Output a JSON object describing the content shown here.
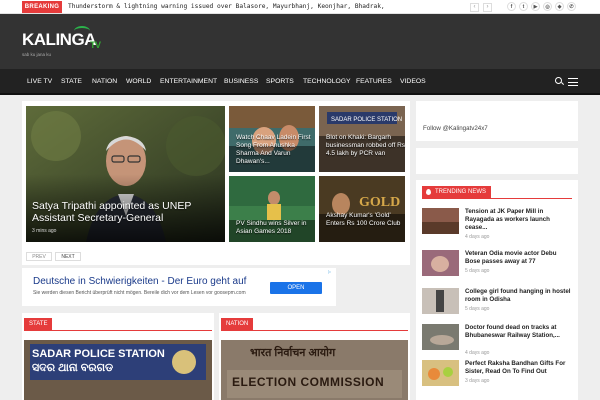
{
  "topbar": {
    "breaking_label": "BREAKING",
    "ticker_text": "Thunderstorm & lightning warning issued over Balasore, Mayurbhanj, Keonjhar, Bhadrak, An...",
    "prev_icon": "chevron-left-icon",
    "next_icon": "chevron-right-icon",
    "social": [
      "f",
      "t",
      "▶",
      "◎",
      "◆",
      "✆"
    ]
  },
  "header": {
    "logo_text": "KALINGA",
    "logo_tv": "TV",
    "tagline": "sab ku jana ku"
  },
  "nav": {
    "items": [
      "LIVE TV",
      "STATE",
      "NATION",
      "WORLD",
      "ENTERTAINMENT",
      "BUSINESS",
      "SPORTS",
      "TECHNOLOGY",
      "FEATURES",
      "VIDEOS"
    ]
  },
  "featured": {
    "main": {
      "title": "Satya Tripathi appointed as UNEP Assistant Secretary-General",
      "time": "3 mins ago"
    },
    "thumbs": [
      {
        "title": "Watch Chaav Ladein First Song From Anushka Sharma And Varun Dhawan's..."
      },
      {
        "title": "Blot on Khaki: Bargarh businessman robbed off Rs 4.5 lakh by PCR van"
      },
      {
        "title": "PV Sindhu wins Silver in Asian Games 2018"
      },
      {
        "title": "Akshay Kumar's 'Gold' Enters Rs 100 Crore Club"
      }
    ],
    "prev_label": "PREV",
    "next_label": "NEXT"
  },
  "ad": {
    "title": "Deutsche in Schwierigkeiten - Der Euro geht auf",
    "desc": "Sie werden diesen Bericht überprüft nicht mögen. Bereile dich vor dem Lesen vor goosepm.com",
    "button": "OPEN"
  },
  "sections": [
    {
      "tag": "STATE",
      "image_text_1": "SADAR POLICE STATION",
      "image_text_2": "ସଦର ଥାନା ବରଗଡ"
    },
    {
      "tag": "NATION",
      "image_text_1": "भारत निर्वाचन आयोग",
      "image_text_2": "ELECTION COMMISSION"
    }
  ],
  "sidebar": {
    "follow_text": "Follow @Kalingatv24x7",
    "trending_label": "TRENDING NEWS",
    "items": [
      {
        "title": "Tension at JK Paper Mill in Rayagada as workers launch cease...",
        "time": "4 days ago"
      },
      {
        "title": "Veteran Odia movie actor Debu Bose passes away at 77",
        "time": "5 days ago"
      },
      {
        "title": "College girl found hanging in hostel room in Odisha",
        "time": "5 days ago"
      },
      {
        "title": "Doctor found dead on tracks at Bhubaneswar Railway Station,...",
        "time": "4 days ago"
      },
      {
        "title": "Perfect Raksha Bandhan Gifts For Sister, Read On To Find Out",
        "time": "3 days ago"
      }
    ]
  },
  "colors": {
    "accent": "#e53b3b",
    "header_bg": "#333333",
    "nav_bg": "#222222",
    "logo_green": "#2bb34b"
  }
}
